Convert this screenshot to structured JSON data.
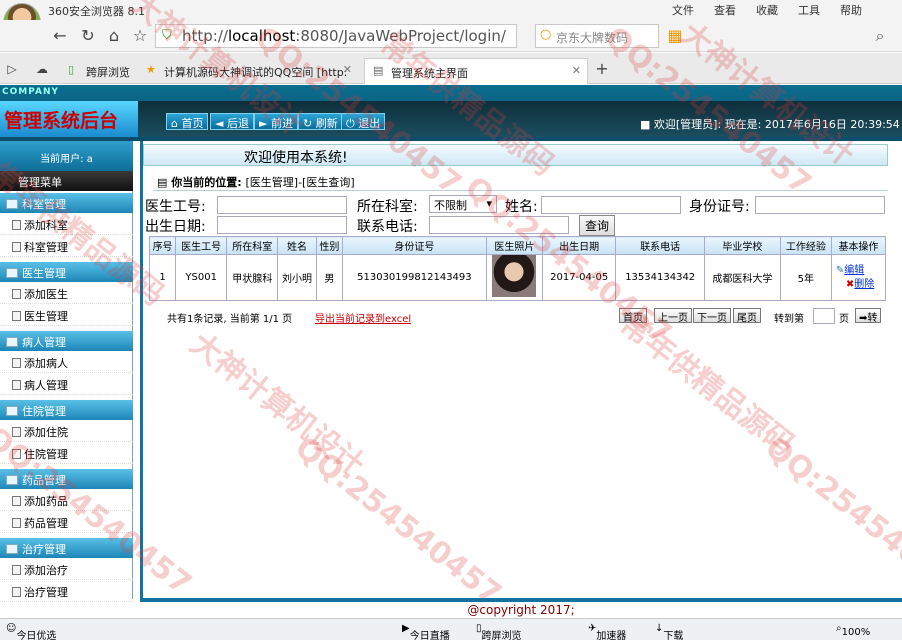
{
  "browser": {
    "title": "360安全浏览器 8.1",
    "menus": [
      "文件",
      "查看",
      "收藏",
      "工具",
      "帮助"
    ],
    "url_prefix": "http://",
    "url_host": "localhost",
    "url_rest": ":8080/JavaWebProject/login/",
    "search_placeholder": "京东大牌数码",
    "tabs": [
      "跨屏浏览",
      "计算机源码大神调试的QQ空间 [http:",
      "管理系统主界面"
    ]
  },
  "app": {
    "company": "COMPANY",
    "logo": "管理系统后台",
    "nav": [
      "首页",
      "后退",
      "前进",
      "刷新",
      "退出"
    ],
    "welcome_user": "欢迎[管理员]:",
    "now_label": "现在是:",
    "datetime": "2017年6月16日 20:39:54"
  },
  "sidebar": {
    "current_user": "当前用户: a",
    "menu_title": "管理菜单",
    "groups": [
      {
        "title": "科室管理",
        "items": [
          "添加科室",
          "科室管理"
        ]
      },
      {
        "title": "医生管理",
        "items": [
          "添加医生",
          "医生管理"
        ]
      },
      {
        "title": "病人管理",
        "items": [
          "添加病人",
          "病人管理"
        ]
      },
      {
        "title": "住院管理",
        "items": [
          "添加住院",
          "住院管理"
        ]
      },
      {
        "title": "药品管理",
        "items": [
          "添加药品",
          "药品管理"
        ]
      },
      {
        "title": "治疗管理",
        "items": [
          "添加治疗",
          "治疗管理"
        ]
      }
    ]
  },
  "main": {
    "welcome": "欢迎使用本系统!",
    "position_label": "你当前的位置:",
    "position_value": "[医生管理]-[医生查询]",
    "filters": {
      "doctor_no": "医生工号:",
      "dept": "所在科室:",
      "dept_value": "不限制",
      "name": "姓名:",
      "id_card": "身份证号:",
      "birth": "出生日期:",
      "phone": "联系电话:",
      "query_button": "查询"
    },
    "columns": [
      "序号",
      "医生工号",
      "所在科室",
      "姓名",
      "性别",
      "身份证号",
      "医生照片",
      "出生日期",
      "联系电话",
      "毕业学校",
      "工作经验",
      "基本操作"
    ],
    "rows": [
      {
        "index": "1",
        "doctor_no": "YS001",
        "dept": "甲状腺科",
        "name": "刘小明",
        "gender": "男",
        "id_card": "513030199812143493",
        "birth": "2017-04-05",
        "phone": "13534134342",
        "school": "成都医科大学",
        "experience": "5年",
        "edit": "编辑",
        "delete": "删除"
      }
    ],
    "pager": {
      "summary": "共有1条记录, 当前第 1/1 页",
      "export": "导出当前记录到excel",
      "first": "首页",
      "prev": "上一页",
      "next": "下一页",
      "last": "尾页",
      "goto": "转到第",
      "page_unit": "页",
      "go": "转"
    }
  },
  "footer": {
    "copyright": "@copyright 2017;"
  },
  "statusbar": {
    "left": "今日优选",
    "live": "今日直播",
    "cross": "跨屏浏览",
    "speed": "加速器",
    "download": "下载",
    "zoom": "100%"
  },
  "watermark": [
    "QQ:254540457",
    "大神计算机设计",
    "常年供精品源码"
  ]
}
